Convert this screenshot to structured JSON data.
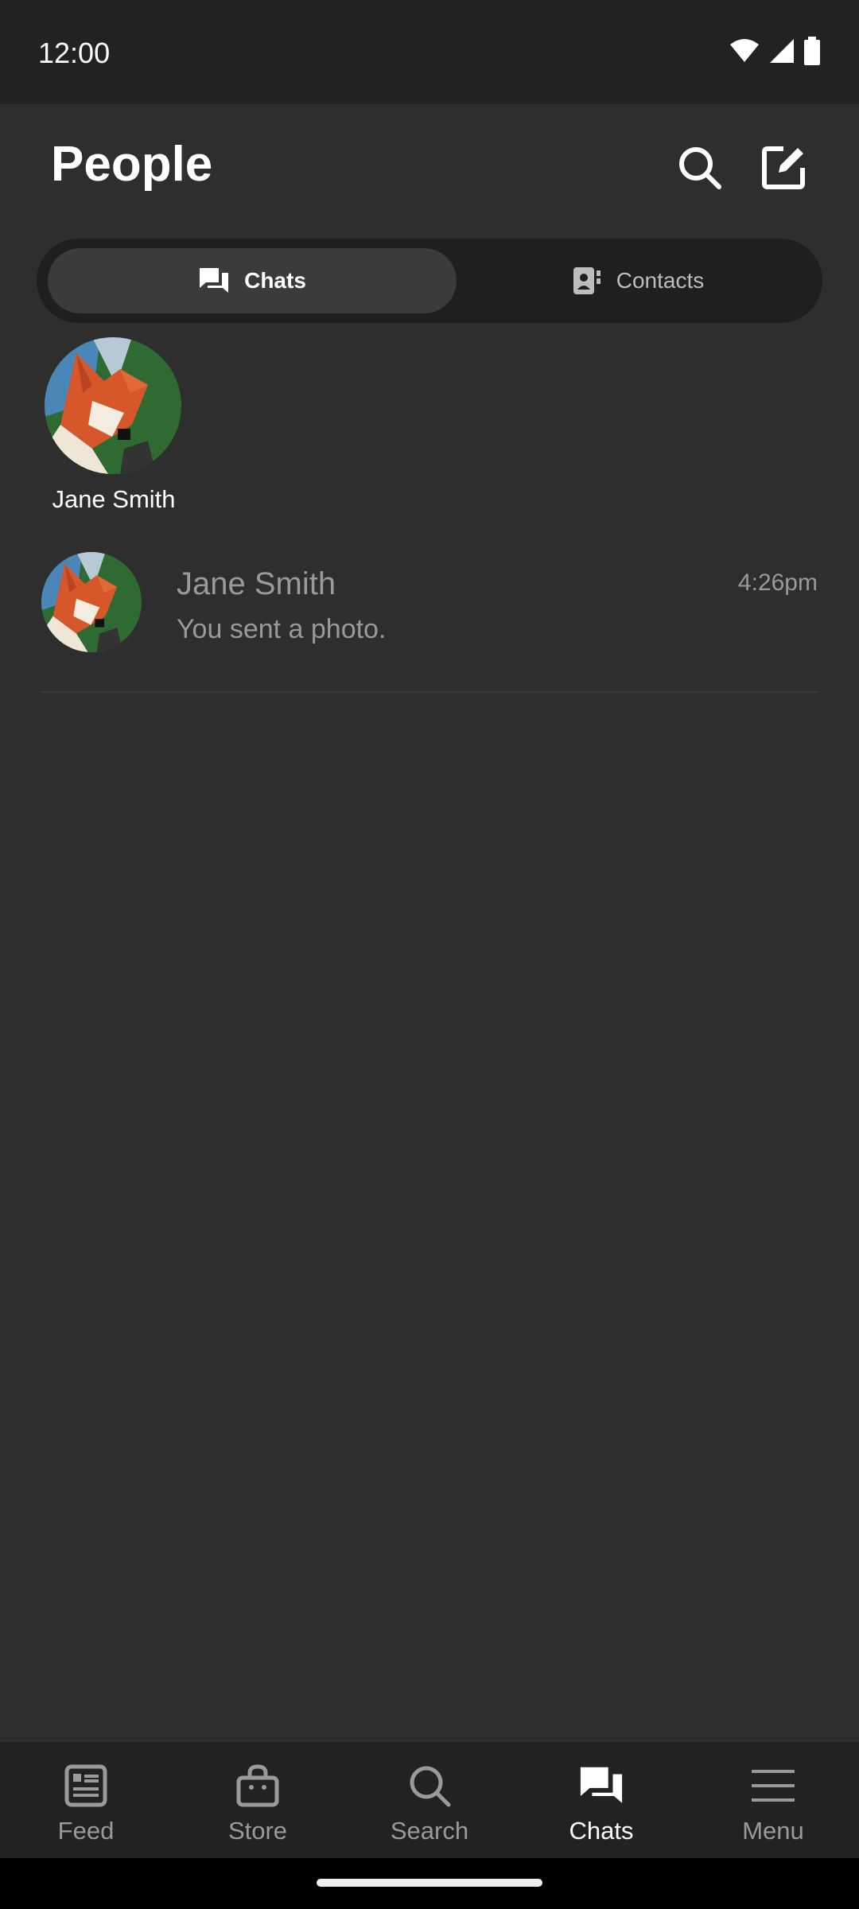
{
  "status_bar": {
    "time": "12:00"
  },
  "header": {
    "title": "People"
  },
  "segments": [
    {
      "label": "Chats",
      "icon": "chat-bubbles-icon",
      "active": true
    },
    {
      "label": "Contacts",
      "icon": "contact-card-icon",
      "active": false
    }
  ],
  "story": {
    "name": "Jane Smith"
  },
  "chats": [
    {
      "name": "Jane Smith",
      "message": "You sent a photo.",
      "time": "4:26pm"
    }
  ],
  "bottom_nav": [
    {
      "label": "Feed",
      "icon": "feed-icon",
      "active": false
    },
    {
      "label": "Store",
      "icon": "store-bag-icon",
      "active": false
    },
    {
      "label": "Search",
      "icon": "search-icon",
      "active": false
    },
    {
      "label": "Chats",
      "icon": "chat-bubbles-icon",
      "active": true
    },
    {
      "label": "Menu",
      "icon": "hamburger-menu-icon",
      "active": false
    }
  ],
  "colors": {
    "background": "#2e2e2e",
    "bar": "#222222",
    "segment_active": "#3a3b3d",
    "muted_text": "#9a9a9a"
  }
}
